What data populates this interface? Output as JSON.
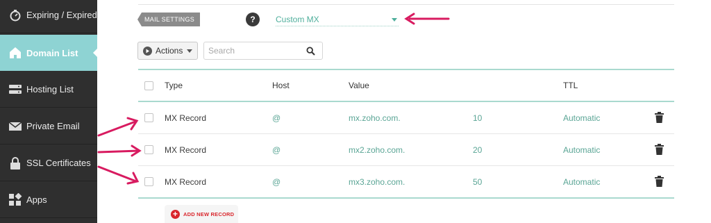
{
  "sidebar": {
    "items": [
      {
        "label": "Expiring / Expired",
        "icon": "stopwatch-icon",
        "active": false
      },
      {
        "label": "Domain List",
        "icon": "home-icon",
        "active": true
      },
      {
        "label": "Hosting List",
        "icon": "server-icon",
        "active": false
      },
      {
        "label": "Private Email",
        "icon": "envelope-icon",
        "active": false
      },
      {
        "label": "SSL Certificates",
        "icon": "lock-icon",
        "active": false
      },
      {
        "label": "Apps",
        "icon": "apps-icon",
        "active": false
      }
    ]
  },
  "mail_settings": {
    "label": "MAIL SETTINGS",
    "help": "?",
    "selected": "Custom MX"
  },
  "toolbar": {
    "actions_label": "Actions",
    "search_placeholder": "Search"
  },
  "table": {
    "headers": {
      "type": "Type",
      "host": "Host",
      "value": "Value",
      "ttl": "TTL"
    },
    "rows": [
      {
        "type": "MX Record",
        "host": "@",
        "value": "mx.zoho.com.",
        "priority": "10",
        "ttl": "Automatic"
      },
      {
        "type": "MX Record",
        "host": "@",
        "value": "mx2.zoho.com.",
        "priority": "20",
        "ttl": "Automatic"
      },
      {
        "type": "MX Record",
        "host": "@",
        "value": "mx3.zoho.com.",
        "priority": "50",
        "ttl": "Automatic"
      }
    ]
  },
  "add_record_label": "ADD NEW RECORD",
  "colors": {
    "sidebar_bg": "#2f2f2f",
    "sidebar_active": "#8ed3d3",
    "accent_teal": "#5aa595",
    "annotation_arrow": "#d81b60",
    "add_red": "#d9262c"
  }
}
